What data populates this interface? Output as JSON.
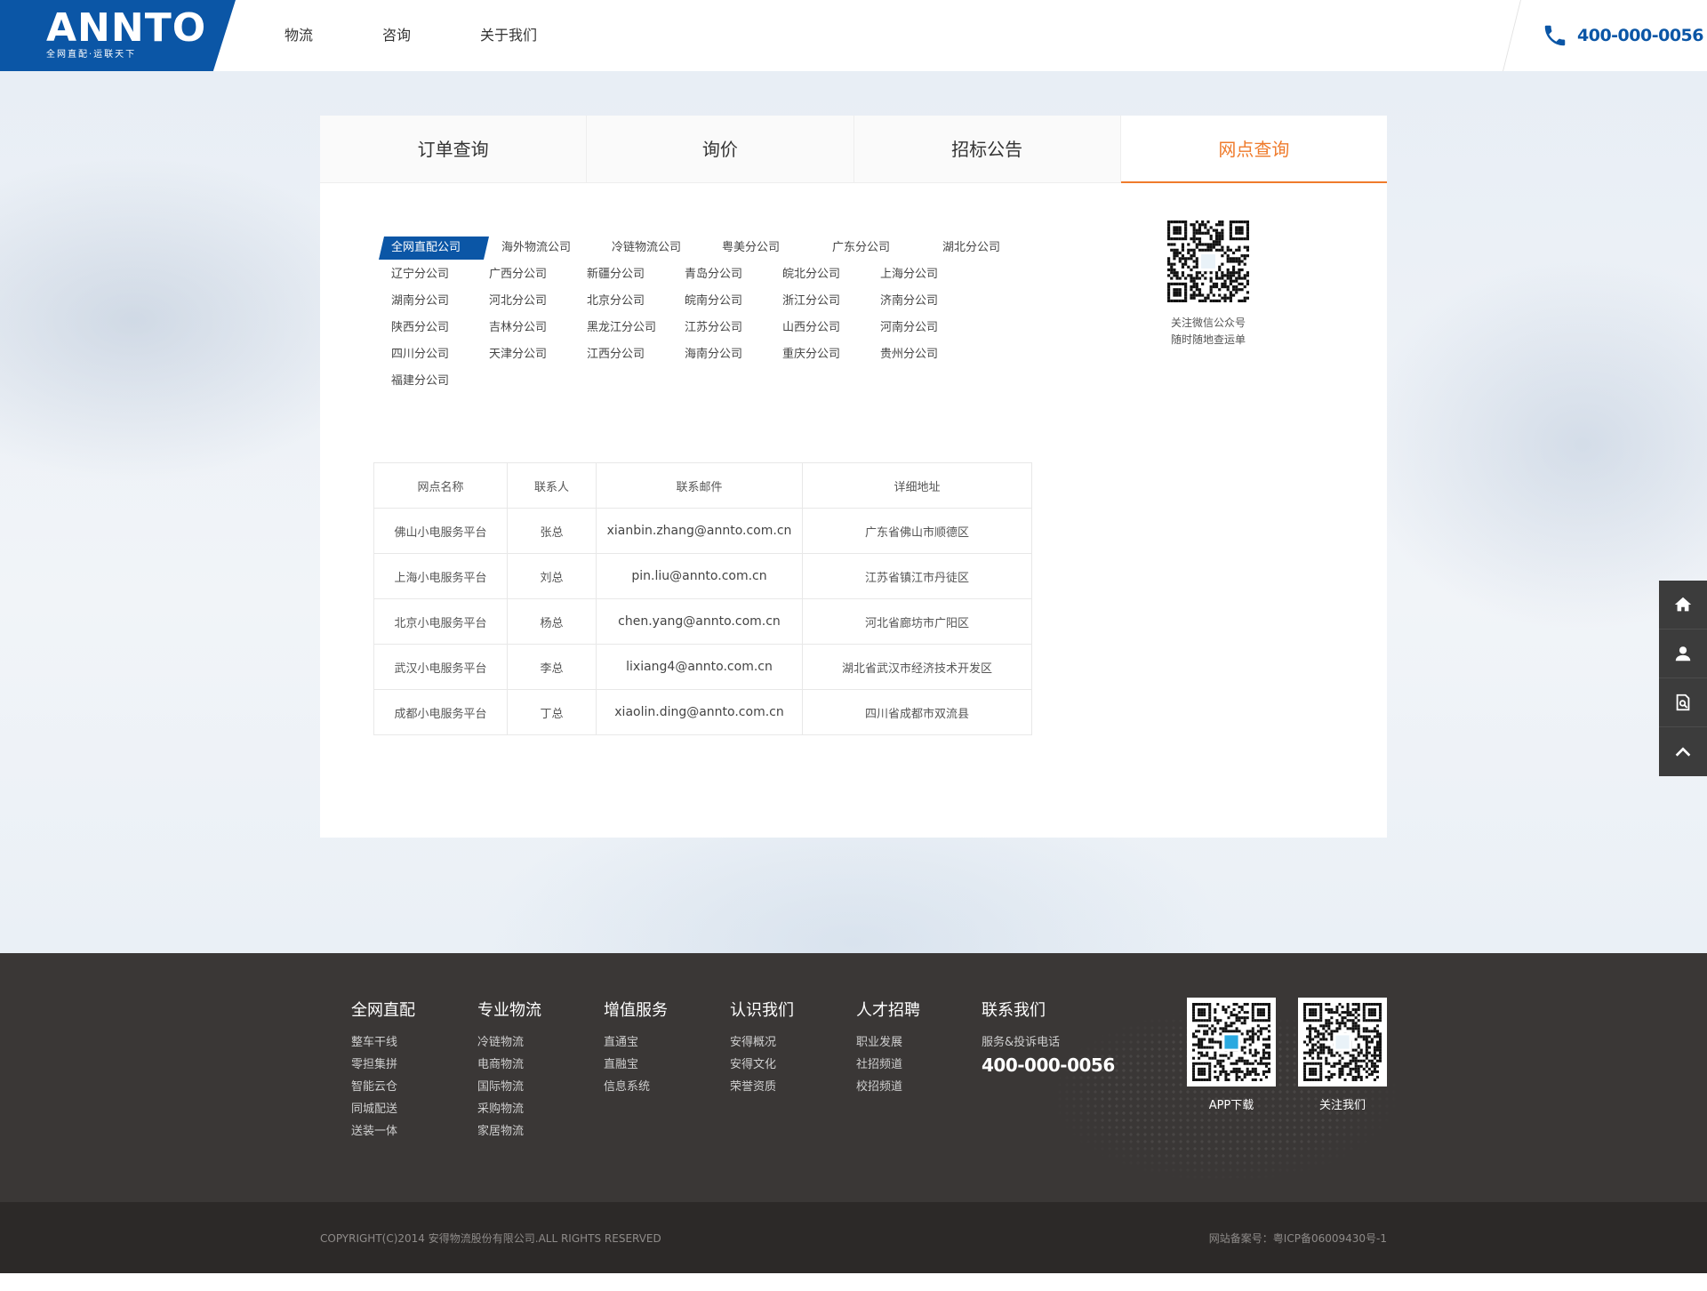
{
  "header": {
    "logo_text": "ANNTO",
    "logo_sub": "全网直配·运联天下",
    "nav": [
      "物流",
      "咨询",
      "关于我们"
    ],
    "phone": "400-000-0056"
  },
  "tabs": [
    {
      "label": "订单查询",
      "active": false
    },
    {
      "label": "询价",
      "active": false
    },
    {
      "label": "招标公告",
      "active": false
    },
    {
      "label": "网点查询",
      "active": true
    }
  ],
  "branches": {
    "rows": [
      [
        "全网直配公司",
        "海外物流公司",
        "冷链物流公司",
        "粤美分公司",
        "广东分公司",
        "湖北分公司"
      ],
      [
        "辽宁分公司",
        "广西分公司",
        "新疆分公司",
        "青岛分公司",
        "皖北分公司",
        "上海分公司"
      ],
      [
        "湖南分公司",
        "河北分公司",
        "北京分公司",
        "皖南分公司",
        "浙江分公司",
        "济南分公司"
      ],
      [
        "陕西分公司",
        "吉林分公司",
        "黑龙江分公司",
        "江苏分公司",
        "山西分公司",
        "河南分公司"
      ],
      [
        "四川分公司",
        "天津分公司",
        "江西分公司",
        "海南分公司",
        "重庆分公司",
        "贵州分公司"
      ],
      [
        "福建分公司"
      ]
    ],
    "active": "全网直配公司"
  },
  "qr": {
    "caption_line1": "关注微信公众号",
    "caption_line2": "随时随地查运单"
  },
  "table": {
    "headers": [
      "网点名称",
      "联系人",
      "联系邮件",
      "详细地址"
    ],
    "rows": [
      [
        "佛山小电服务平台",
        "张总",
        "xianbin.zhang@annto.com.cn",
        "广东省佛山市顺德区"
      ],
      [
        "上海小电服务平台",
        "刘总",
        "pin.liu@annto.com.cn",
        "江苏省镇江市丹徒区"
      ],
      [
        "北京小电服务平台",
        "杨总",
        "chen.yang@annto.com.cn",
        "河北省廊坊市广阳区"
      ],
      [
        "武汉小电服务平台",
        "李总",
        "lixiang4@annto.com.cn",
        "湖北省武汉市经济技术开发区"
      ],
      [
        "成都小电服务平台",
        "丁总",
        "xiaolin.ding@annto.com.cn",
        "四川省成都市双流县"
      ]
    ]
  },
  "sidebar": [
    "home-icon",
    "user-icon",
    "search-doc-icon",
    "back-to-top-icon"
  ],
  "footer": {
    "columns": [
      {
        "title": "全网直配",
        "links": [
          "整车干线",
          "零担集拼",
          "智能云仓",
          "同城配送",
          "送装一体"
        ]
      },
      {
        "title": "专业物流",
        "links": [
          "冷链物流",
          "电商物流",
          "国际物流",
          "采购物流",
          "家居物流"
        ]
      },
      {
        "title": "增值服务",
        "links": [
          "直通宝",
          "直融宝",
          "信息系统"
        ]
      },
      {
        "title": "认识我们",
        "links": [
          "安得概况",
          "安得文化",
          "荣誉资质"
        ]
      },
      {
        "title": "人才招聘",
        "links": [
          "职业发展",
          "社招频道",
          "校招频道"
        ]
      }
    ],
    "contact": {
      "title": "联系我们",
      "sub": "服务&投诉电话",
      "phone": "400-000-0056"
    },
    "qr_labels": [
      "APP下载",
      "关注我们"
    ],
    "copyright": "COPYRIGHT(C)2014 安得物流股份有限公司.ALL RIGHTS RESERVED",
    "icp": "网站备案号：粤ICP备06009430号-1"
  },
  "colors": {
    "brand": "#0b56a6",
    "accent": "#ef7b2c",
    "footer": "#3a3736"
  }
}
